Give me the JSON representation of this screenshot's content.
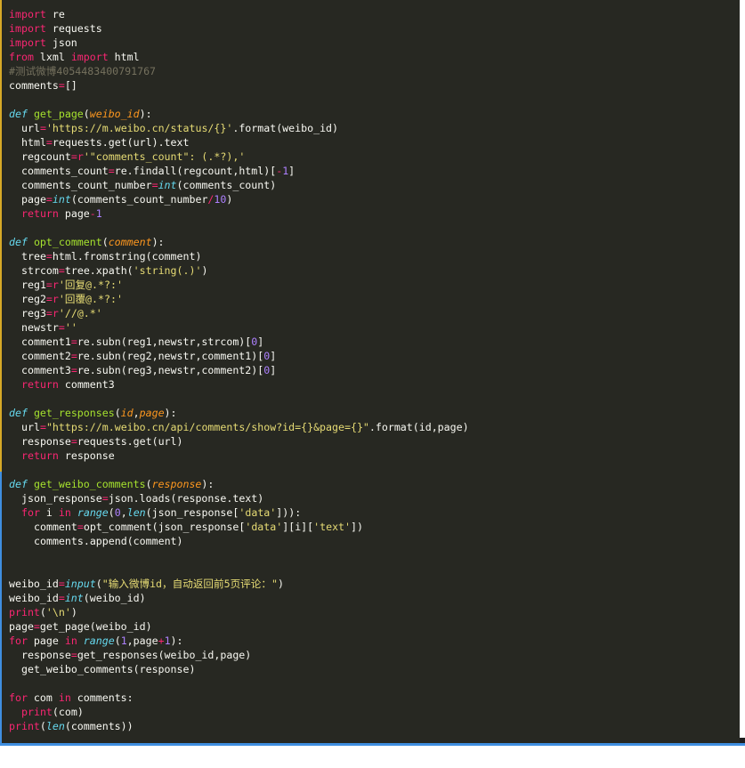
{
  "lines": [
    {
      "indent": 0,
      "tokens": [
        [
          "kw",
          "import"
        ],
        [
          "t",
          " re"
        ]
      ]
    },
    {
      "indent": 0,
      "tokens": [
        [
          "kw",
          "import"
        ],
        [
          "t",
          " requests"
        ]
      ]
    },
    {
      "indent": 0,
      "tokens": [
        [
          "kw",
          "import"
        ],
        [
          "t",
          " json"
        ]
      ]
    },
    {
      "indent": 0,
      "tokens": [
        [
          "kw",
          "from"
        ],
        [
          "t",
          " lxml "
        ],
        [
          "kw",
          "import"
        ],
        [
          "t",
          " html"
        ]
      ]
    },
    {
      "indent": 0,
      "tokens": [
        [
          "cmt",
          "#测试微博4054483400791767"
        ]
      ]
    },
    {
      "indent": 0,
      "tokens": [
        [
          "t",
          "comments"
        ],
        [
          "op",
          "="
        ],
        [
          "t",
          "[]"
        ]
      ]
    },
    {
      "indent": 0,
      "tokens": []
    },
    {
      "indent": 0,
      "tokens": [
        [
          "def",
          "def"
        ],
        [
          "t",
          " "
        ],
        [
          "fn",
          "get_page"
        ],
        [
          "t",
          "("
        ],
        [
          "param",
          "weibo_id"
        ],
        [
          "t",
          "):"
        ]
      ]
    },
    {
      "indent": 1,
      "tokens": [
        [
          "t",
          "url"
        ],
        [
          "op",
          "="
        ],
        [
          "str",
          "'https://m.weibo.cn/status/{}'"
        ],
        [
          "t",
          ".format(weibo_id)"
        ]
      ]
    },
    {
      "indent": 1,
      "tokens": [
        [
          "t",
          "html"
        ],
        [
          "op",
          "="
        ],
        [
          "t",
          "requests.get(url).text"
        ]
      ]
    },
    {
      "indent": 1,
      "tokens": [
        [
          "t",
          "regcount"
        ],
        [
          "op",
          "="
        ],
        [
          "kw",
          "r"
        ],
        [
          "str",
          "'\"comments_count\": (.*?),'"
        ]
      ]
    },
    {
      "indent": 1,
      "tokens": [
        [
          "t",
          "comments_count"
        ],
        [
          "op",
          "="
        ],
        [
          "t",
          "re.findall(regcount,html)["
        ],
        [
          "op",
          "-"
        ],
        [
          "num",
          "1"
        ],
        [
          "t",
          "]"
        ]
      ]
    },
    {
      "indent": 1,
      "tokens": [
        [
          "t",
          "comments_count_number"
        ],
        [
          "op",
          "="
        ],
        [
          "bi",
          "int"
        ],
        [
          "t",
          "(comments_count)"
        ]
      ]
    },
    {
      "indent": 1,
      "tokens": [
        [
          "t",
          "page"
        ],
        [
          "op",
          "="
        ],
        [
          "bi",
          "int"
        ],
        [
          "t",
          "(comments_count_number"
        ],
        [
          "op",
          "/"
        ],
        [
          "num",
          "10"
        ],
        [
          "t",
          ")"
        ]
      ]
    },
    {
      "indent": 1,
      "tokens": [
        [
          "kw",
          "return"
        ],
        [
          "t",
          " page"
        ],
        [
          "op",
          "-"
        ],
        [
          "num",
          "1"
        ]
      ]
    },
    {
      "indent": 0,
      "tokens": []
    },
    {
      "indent": 0,
      "tokens": [
        [
          "def",
          "def"
        ],
        [
          "t",
          " "
        ],
        [
          "fn",
          "opt_comment"
        ],
        [
          "t",
          "("
        ],
        [
          "param",
          "comment"
        ],
        [
          "t",
          "):"
        ]
      ]
    },
    {
      "indent": 1,
      "tokens": [
        [
          "t",
          "tree"
        ],
        [
          "op",
          "="
        ],
        [
          "t",
          "html.fromstring(comment)"
        ]
      ]
    },
    {
      "indent": 1,
      "tokens": [
        [
          "t",
          "strcom"
        ],
        [
          "op",
          "="
        ],
        [
          "t",
          "tree.xpath("
        ],
        [
          "str",
          "'string(.)'"
        ],
        [
          "t",
          ")"
        ]
      ]
    },
    {
      "indent": 1,
      "tokens": [
        [
          "t",
          "reg1"
        ],
        [
          "op",
          "="
        ],
        [
          "kw",
          "r"
        ],
        [
          "str",
          "'回复@.*?:'"
        ]
      ]
    },
    {
      "indent": 1,
      "tokens": [
        [
          "t",
          "reg2"
        ],
        [
          "op",
          "="
        ],
        [
          "kw",
          "r"
        ],
        [
          "str",
          "'回覆@.*?:'"
        ]
      ]
    },
    {
      "indent": 1,
      "tokens": [
        [
          "t",
          "reg3"
        ],
        [
          "op",
          "="
        ],
        [
          "kw",
          "r"
        ],
        [
          "str",
          "'//@.*'"
        ]
      ]
    },
    {
      "indent": 1,
      "tokens": [
        [
          "t",
          "newstr"
        ],
        [
          "op",
          "="
        ],
        [
          "str",
          "''"
        ]
      ]
    },
    {
      "indent": 1,
      "tokens": [
        [
          "t",
          "comment1"
        ],
        [
          "op",
          "="
        ],
        [
          "t",
          "re.subn(reg1,newstr,strcom)["
        ],
        [
          "num",
          "0"
        ],
        [
          "t",
          "]"
        ]
      ]
    },
    {
      "indent": 1,
      "tokens": [
        [
          "t",
          "comment2"
        ],
        [
          "op",
          "="
        ],
        [
          "t",
          "re.subn(reg2,newstr,comment1)["
        ],
        [
          "num",
          "0"
        ],
        [
          "t",
          "]"
        ]
      ]
    },
    {
      "indent": 1,
      "tokens": [
        [
          "t",
          "comment3"
        ],
        [
          "op",
          "="
        ],
        [
          "t",
          "re.subn(reg3,newstr,comment2)["
        ],
        [
          "num",
          "0"
        ],
        [
          "t",
          "]"
        ]
      ]
    },
    {
      "indent": 1,
      "tokens": [
        [
          "kw",
          "return"
        ],
        [
          "t",
          " comment3"
        ]
      ]
    },
    {
      "indent": 0,
      "tokens": []
    },
    {
      "indent": 0,
      "tokens": [
        [
          "def",
          "def"
        ],
        [
          "t",
          " "
        ],
        [
          "fn",
          "get_responses"
        ],
        [
          "t",
          "("
        ],
        [
          "param",
          "id"
        ],
        [
          "t",
          ","
        ],
        [
          "param",
          "page"
        ],
        [
          "t",
          "):"
        ]
      ]
    },
    {
      "indent": 1,
      "tokens": [
        [
          "t",
          "url"
        ],
        [
          "op",
          "="
        ],
        [
          "str",
          "\"https://m.weibo.cn/api/comments/show?id={}&page={}\""
        ],
        [
          "t",
          ".format(id,page)"
        ]
      ]
    },
    {
      "indent": 1,
      "tokens": [
        [
          "t",
          "response"
        ],
        [
          "op",
          "="
        ],
        [
          "t",
          "requests.get(url)"
        ]
      ]
    },
    {
      "indent": 1,
      "tokens": [
        [
          "kw",
          "return"
        ],
        [
          "t",
          " response"
        ]
      ]
    },
    {
      "indent": 0,
      "tokens": []
    },
    {
      "indent": 0,
      "tokens": [
        [
          "def",
          "def"
        ],
        [
          "t",
          " "
        ],
        [
          "fn",
          "get_weibo_comments"
        ],
        [
          "t",
          "("
        ],
        [
          "param",
          "response"
        ],
        [
          "t",
          "):"
        ]
      ]
    },
    {
      "indent": 1,
      "tokens": [
        [
          "t",
          "json_response"
        ],
        [
          "op",
          "="
        ],
        [
          "t",
          "json.loads(response.text)"
        ]
      ]
    },
    {
      "indent": 1,
      "tokens": [
        [
          "kw",
          "for"
        ],
        [
          "t",
          " i "
        ],
        [
          "kw",
          "in"
        ],
        [
          "t",
          " "
        ],
        [
          "bi",
          "range"
        ],
        [
          "t",
          "("
        ],
        [
          "num",
          "0"
        ],
        [
          "t",
          ","
        ],
        [
          "bi",
          "len"
        ],
        [
          "t",
          "(json_response["
        ],
        [
          "str",
          "'data'"
        ],
        [
          "t",
          "])):"
        ]
      ]
    },
    {
      "indent": 2,
      "tokens": [
        [
          "t",
          "comment"
        ],
        [
          "op",
          "="
        ],
        [
          "t",
          "opt_comment(json_response["
        ],
        [
          "str",
          "'data'"
        ],
        [
          "t",
          "][i]["
        ],
        [
          "str",
          "'text'"
        ],
        [
          "t",
          "])"
        ]
      ]
    },
    {
      "indent": 2,
      "tokens": [
        [
          "t",
          "comments.append(comment)"
        ]
      ]
    },
    {
      "indent": 0,
      "tokens": []
    },
    {
      "indent": 0,
      "tokens": []
    },
    {
      "indent": 0,
      "tokens": [
        [
          "t",
          "weibo_id"
        ],
        [
          "op",
          "="
        ],
        [
          "bi",
          "input"
        ],
        [
          "t",
          "("
        ],
        [
          "str",
          "\"输入微博id，自动返回前5页评论：\""
        ],
        [
          "t",
          ")"
        ]
      ]
    },
    {
      "indent": 0,
      "tokens": [
        [
          "t",
          "weibo_id"
        ],
        [
          "op",
          "="
        ],
        [
          "bi",
          "int"
        ],
        [
          "t",
          "(weibo_id)"
        ]
      ]
    },
    {
      "indent": 0,
      "tokens": [
        [
          "kw",
          "print"
        ],
        [
          "t",
          "("
        ],
        [
          "str",
          "'\\n'"
        ],
        [
          "t",
          ")"
        ]
      ]
    },
    {
      "indent": 0,
      "tokens": [
        [
          "t",
          "page"
        ],
        [
          "op",
          "="
        ],
        [
          "t",
          "get_page(weibo_id)"
        ]
      ]
    },
    {
      "indent": 0,
      "tokens": [
        [
          "kw",
          "for"
        ],
        [
          "t",
          " page "
        ],
        [
          "kw",
          "in"
        ],
        [
          "t",
          " "
        ],
        [
          "bi",
          "range"
        ],
        [
          "t",
          "("
        ],
        [
          "num",
          "1"
        ],
        [
          "t",
          ",page"
        ],
        [
          "op",
          "+"
        ],
        [
          "num",
          "1"
        ],
        [
          "t",
          "):"
        ]
      ]
    },
    {
      "indent": 1,
      "tokens": [
        [
          "t",
          "response"
        ],
        [
          "op",
          "="
        ],
        [
          "t",
          "get_responses(weibo_id,page)"
        ]
      ]
    },
    {
      "indent": 1,
      "tokens": [
        [
          "t",
          "get_weibo_comments(response)"
        ]
      ]
    },
    {
      "indent": 0,
      "tokens": []
    },
    {
      "indent": 0,
      "tokens": [
        [
          "kw",
          "for"
        ],
        [
          "t",
          " com "
        ],
        [
          "kw",
          "in"
        ],
        [
          "t",
          " comments:"
        ]
      ]
    },
    {
      "indent": 1,
      "tokens": [
        [
          "kw",
          "print"
        ],
        [
          "t",
          "(com)"
        ]
      ]
    },
    {
      "indent": 0,
      "tokens": [
        [
          "kw",
          "print"
        ],
        [
          "t",
          "("
        ],
        [
          "bi",
          "len"
        ],
        [
          "t",
          "(comments))"
        ]
      ]
    }
  ]
}
